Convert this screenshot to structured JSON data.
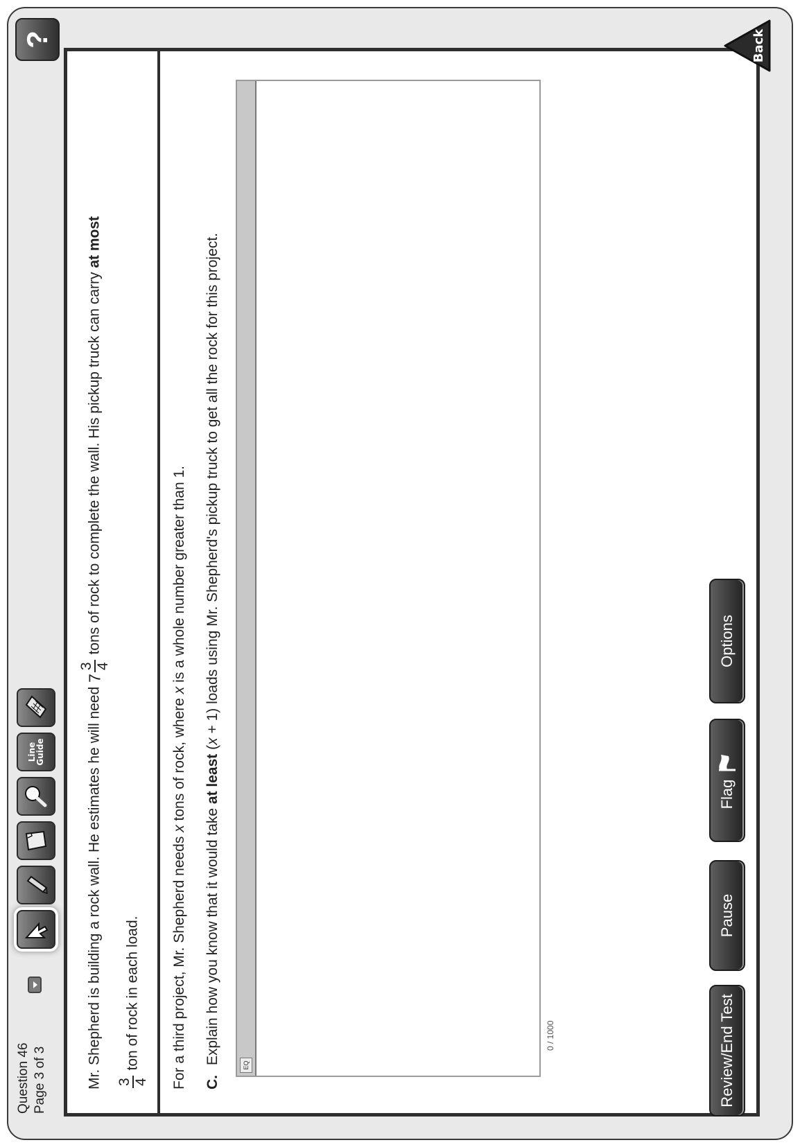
{
  "header": {
    "question_label": "Question 46",
    "page_label": "Page 3 of 3",
    "tools": [
      {
        "name": "pointer",
        "icon": "pointer-arrow-icon"
      },
      {
        "name": "highlighter",
        "icon": "highlighter-icon"
      },
      {
        "name": "sticky-note",
        "icon": "sticky-note-icon"
      },
      {
        "name": "magnifier",
        "icon": "magnifier-icon"
      },
      {
        "name": "line-guide",
        "label_line1": "Line",
        "label_line2": "Guide"
      },
      {
        "name": "calculator",
        "icon": "calculator-icon"
      }
    ],
    "help_label": "?"
  },
  "stimulus": {
    "line1_a": "Mr. Shepherd is building a rock wall. He estimates he will need",
    "mixed_whole": "7",
    "mixed_num": "3",
    "mixed_den": "4",
    "line1_b": "tons of rock to complete the wall. His pickup truck can carry",
    "line1_bold": "at most",
    "frac2_num": "3",
    "frac2_den": "4",
    "line2": "ton of rock in each load."
  },
  "question": {
    "intro_a": "For a third project, Mr. Shepherd needs",
    "intro_var": "x",
    "intro_b": "tons of rock, where",
    "intro_var2": "x",
    "intro_c": "is a whole number greater than 1.",
    "letter": "C.",
    "prompt_a": "Explain how you know that it would take",
    "prompt_bold": "at least",
    "prompt_b": "(",
    "prompt_var": "x",
    "prompt_c": "+ 1) loads using Mr. Shepherd's pickup truck to get all the rock for this project."
  },
  "answer_box": {
    "eq_button": "EQ",
    "value": "",
    "counter": "0 / 1000"
  },
  "footer": {
    "review_label": "Review/End Test",
    "pause_label": "Pause",
    "flag_label": "Flag",
    "options_label": "Options",
    "back_label": "Back"
  }
}
